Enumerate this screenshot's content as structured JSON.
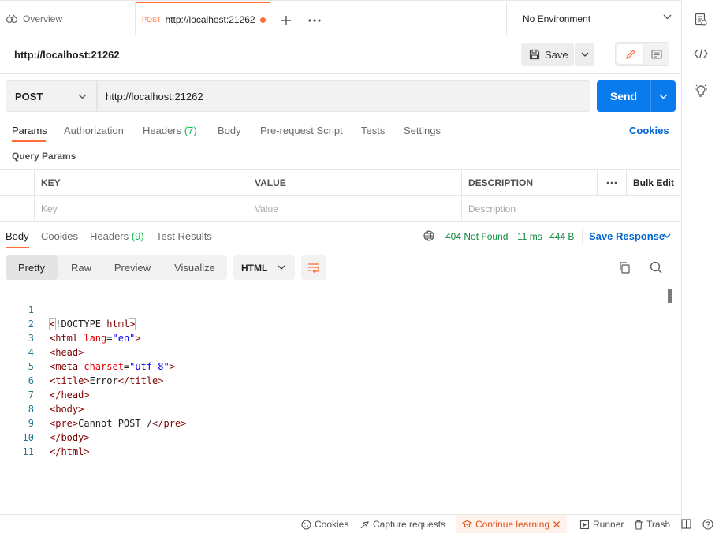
{
  "tabs": {
    "overview_label": "Overview",
    "active_method": "POST",
    "active_url": "http://localhost:21262",
    "environment": "No Environment"
  },
  "request": {
    "name": "http://localhost:21262",
    "save_label": "Save",
    "method": "POST",
    "url": "http://localhost:21262",
    "send_label": "Send"
  },
  "request_tabs": {
    "params": "Params",
    "authorization": "Authorization",
    "headers": "Headers",
    "headers_count": "(7)",
    "body": "Body",
    "pre_request": "Pre-request Script",
    "tests": "Tests",
    "settings": "Settings",
    "cookies": "Cookies"
  },
  "query_params": {
    "title": "Query Params",
    "columns": [
      "KEY",
      "VALUE",
      "DESCRIPTION"
    ],
    "bulk_edit": "Bulk Edit",
    "placeholders": [
      "Key",
      "Value",
      "Description"
    ]
  },
  "response": {
    "tabs": {
      "body": "Body",
      "cookies": "Cookies",
      "headers": "Headers",
      "headers_count": "(9)",
      "test_results": "Test Results"
    },
    "status": "404 Not Found",
    "time": "11 ms",
    "size": "444 B",
    "save_response": "Save Response",
    "formats": [
      "Pretty",
      "Raw",
      "Preview",
      "Visualize"
    ],
    "language": "HTML",
    "line_numbers": [
      "1",
      "2",
      "3",
      "4",
      "5",
      "6",
      "7",
      "8",
      "9",
      "10",
      "11"
    ],
    "code": {
      "l1_a": "<",
      "l1_b": "!DOCTYPE ",
      "l1_c": "html",
      "l1_d": ">",
      "l2_a": "<html ",
      "l2_b": "lang",
      "l2_c": "=",
      "l2_d": "\"en\"",
      "l2_e": ">",
      "l3": "<head>",
      "l4_a": "<meta ",
      "l4_b": "charset",
      "l4_c": "=",
      "l4_d": "\"utf-8\"",
      "l4_e": ">",
      "l5_a": "<title>",
      "l5_b": "Error",
      "l5_c": "</title>",
      "l6": "</head>",
      "l7": "<body>",
      "l8_a": "<pre>",
      "l8_b": "Cannot POST /",
      "l8_c": "</pre>",
      "l9": "</body>",
      "l10": "</html>"
    }
  },
  "footer": {
    "cookies": "Cookies",
    "capture": "Capture requests",
    "learning": "Continue learning",
    "runner": "Runner",
    "trash": "Trash"
  },
  "colors": {
    "accent": "#ff6c37",
    "primary": "#097bed",
    "link": "#0265d2",
    "status_ok": "#0f8a3e"
  }
}
